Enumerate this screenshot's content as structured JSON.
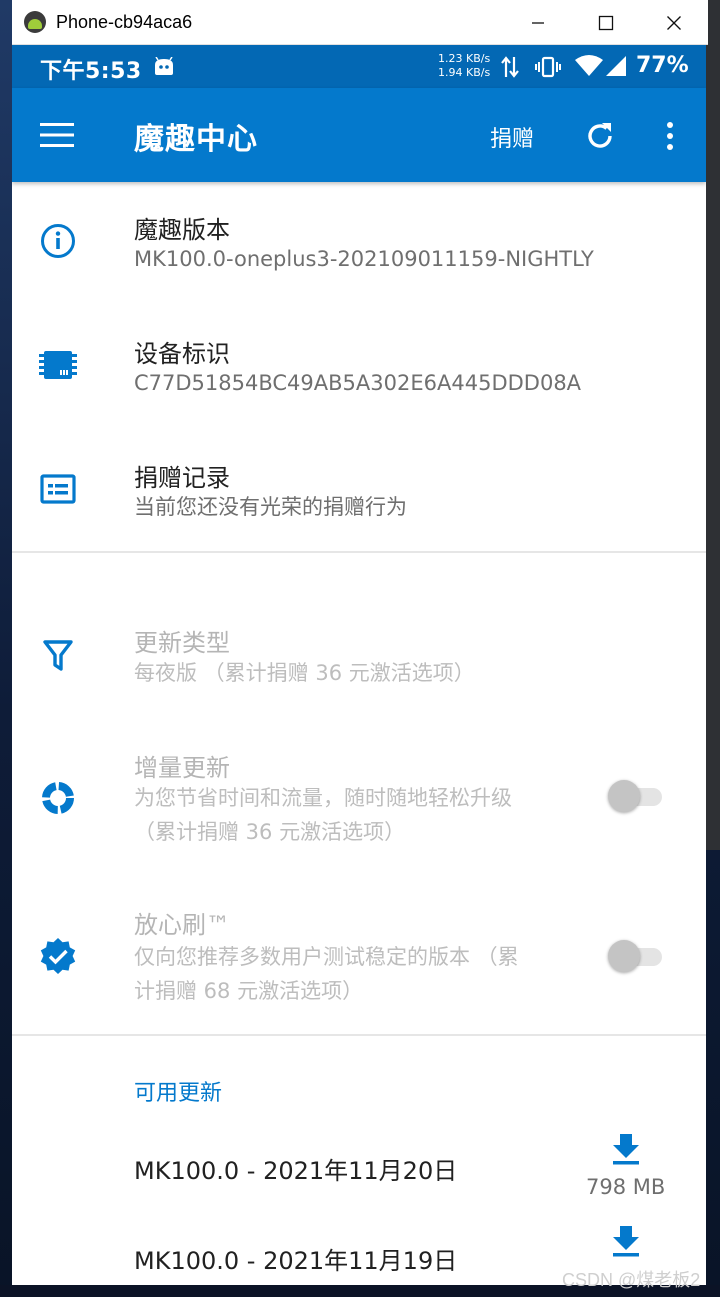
{
  "window": {
    "title": "Phone-cb94aca6",
    "controls": [
      "minimize",
      "maximize",
      "close"
    ]
  },
  "statusbar": {
    "time": "下午5:53",
    "speed_up": "1.23 KB/s",
    "speed_down": "1.94 KB/s",
    "battery": "77%",
    "icons": [
      "android-notification-icon",
      "data-updown-icon",
      "vibrate-icon",
      "wifi-icon",
      "signal-icon"
    ]
  },
  "appbar": {
    "title": "魔趣中心",
    "donate_label": "捐赠",
    "icons": [
      "menu-icon",
      "refresh-icon",
      "more-vert-icon"
    ]
  },
  "info_items": [
    {
      "title": "魔趣版本",
      "subtitle": "MK100.0-oneplus3-202109011159-NIGHTLY",
      "icon": "info-icon"
    },
    {
      "title": "设备标识",
      "subtitle": "C77D51854BC49AB5A302E6A445DDD08A",
      "icon": "chip-icon"
    },
    {
      "title": "捐赠记录",
      "subtitle": "当前您还没有光荣的捐赠行为",
      "icon": "card-icon"
    }
  ],
  "settings": {
    "update_type": {
      "title": "更新类型",
      "subtitle": "每夜版 （累计捐赠 36 元激活选项）",
      "icon": "filter-icon"
    },
    "incremental": {
      "title": "增量更新",
      "subtitle_line1": "为您节省时间和流量，随时随地轻松升级",
      "subtitle_line2": "（累计捐赠 36 元激活选项）",
      "enabled": false,
      "icon": "donut-icon"
    },
    "safe_flash": {
      "title": "放心刷™",
      "subtitle_line1": "仅向您推荐多数用户测试稳定的版本 （累",
      "subtitle_line2": "计捐赠 68 元激活选项）",
      "enabled": false,
      "icon": "verified-badge-icon"
    }
  },
  "updates": {
    "header": "可用更新",
    "items": [
      {
        "name": "MK100.0 - 2021年11月20日",
        "size": "798 MB"
      },
      {
        "name": "MK100.0 - 2021年11月19日",
        "size": ""
      }
    ]
  },
  "watermark": "CSDN @煤老板2",
  "colors": {
    "status_bar": "#0368b4",
    "app_bar": "#0479cc",
    "accent": "#0479cc"
  }
}
